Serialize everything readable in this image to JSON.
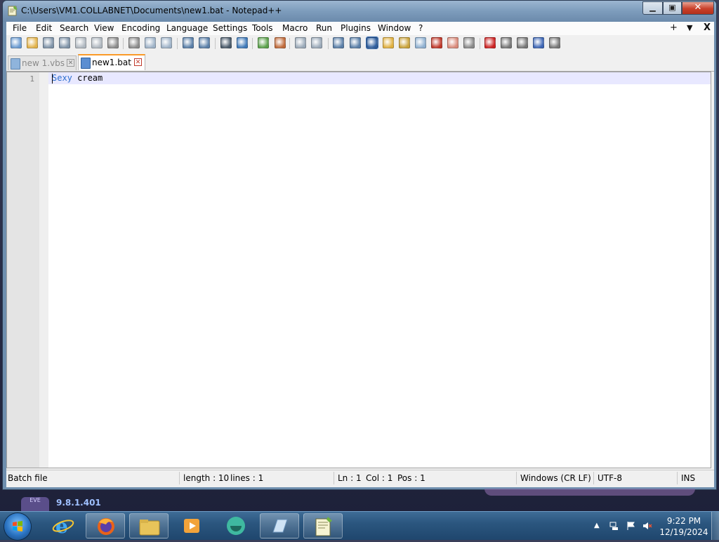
{
  "window": {
    "title": "C:\\Users\\VM1.COLLABNET\\Documents\\new1.bat - Notepad++",
    "min_label": "▭",
    "max_label": "◻",
    "close_label": "✕"
  },
  "menu": {
    "items": [
      "File",
      "Edit",
      "Search",
      "View",
      "Encoding",
      "Language",
      "Settings",
      "Tools",
      "Macro",
      "Run",
      "Plugins",
      "Window",
      "?"
    ],
    "right_plus": "+",
    "right_down": "▼",
    "right_close": "X"
  },
  "toolbar": {
    "icons": [
      "new-file-icon",
      "open-file-icon",
      "save-icon",
      "save-all-icon",
      "close-icon",
      "close-all-icon",
      "print-icon",
      "cut-icon",
      "copy-icon",
      "paste-icon",
      "undo-icon",
      "redo-icon",
      "find-icon",
      "replace-icon",
      "zoom-in-icon",
      "zoom-out-icon",
      "sync-vertical-icon",
      "sync-horizontal-icon",
      "word-wrap-icon",
      "show-all-chars-icon",
      "indent-guide-icon",
      "doc-map-icon",
      "function-list-icon",
      "folder-workspace-icon",
      "monitoring-icon",
      "doc-list-icon",
      "eye-icon",
      "record-macro-icon",
      "stop-record-icon",
      "playback-icon",
      "run-multiple-icon",
      "save-macro-icon"
    ]
  },
  "tabs": [
    {
      "label": "new 1.vbs",
      "active": false,
      "close": "✕"
    },
    {
      "label": "new1.bat",
      "active": true,
      "close": "✕"
    }
  ],
  "editor": {
    "line_number": "1",
    "keyword": "Sexy",
    "text": " cream"
  },
  "status": {
    "file_type": "Batch file",
    "length": "length : 10",
    "lines": "lines : 1",
    "ln": "Ln : 1",
    "col": "Col : 1",
    "pos": "Pos : 1",
    "eol": "Windows (CR LF)",
    "encoding": "UTF-8",
    "mode": "INS"
  },
  "desktop": {
    "widget_label": "EVE",
    "version": "9.8.1.401"
  },
  "taskbar": {
    "apps": [
      "internet-explorer-icon",
      "firefox-icon",
      "file-explorer-icon",
      "media-player-icon",
      "app-icon",
      "notes-icon",
      "notepad-plus-plus-icon"
    ],
    "time": "9:22 PM",
    "date": "12/19/2024"
  },
  "colors": {
    "keyword": "#2e6fcf",
    "active_tab_accent": "#fa9a28",
    "current_line": "#e8e8ff"
  }
}
